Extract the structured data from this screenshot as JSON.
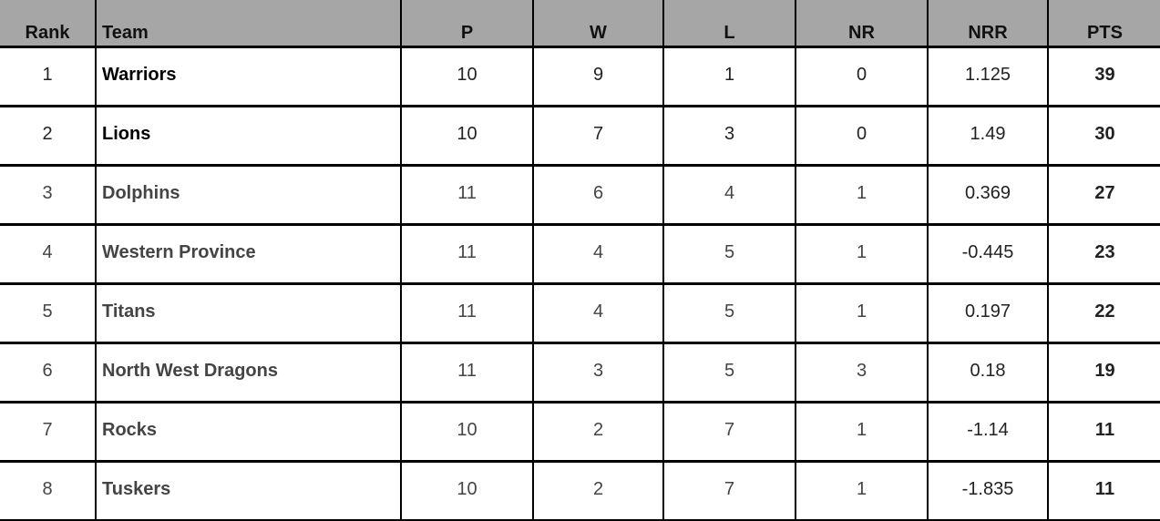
{
  "table": {
    "headers": {
      "rank": "Rank",
      "team": "Team",
      "p": "P",
      "w": "W",
      "l": "L",
      "nr": "NR",
      "nrr": "NRR",
      "pts": "PTS"
    },
    "header_bg": "#a6a6a6",
    "rows": [
      {
        "rank": "1",
        "team": "Warriors",
        "p": "10",
        "w": "9",
        "l": "1",
        "nr": "0",
        "nrr": "1.125",
        "pts": "39"
      },
      {
        "rank": "2",
        "team": "Lions",
        "p": "10",
        "w": "7",
        "l": "3",
        "nr": "0",
        "nrr": "1.49",
        "pts": "30"
      },
      {
        "rank": "3",
        "team": "Dolphins",
        "p": "11",
        "w": "6",
        "l": "4",
        "nr": "1",
        "nrr": "0.369",
        "pts": "27"
      },
      {
        "rank": "4",
        "team": "Western Province",
        "p": "11",
        "w": "4",
        "l": "5",
        "nr": "1",
        "nrr": "-0.445",
        "pts": "23"
      },
      {
        "rank": "5",
        "team": "Titans",
        "p": "11",
        "w": "4",
        "l": "5",
        "nr": "1",
        "nrr": "0.197",
        "pts": "22"
      },
      {
        "rank": "6",
        "team": "North West Dragons",
        "p": "11",
        "w": "3",
        "l": "5",
        "nr": "3",
        "nrr": "0.18",
        "pts": "19"
      },
      {
        "rank": "7",
        "team": "Rocks",
        "p": "10",
        "w": "2",
        "l": "7",
        "nr": "1",
        "nrr": "-1.14",
        "pts": "11"
      },
      {
        "rank": "8",
        "team": "Tuskers",
        "p": "10",
        "w": "2",
        "l": "7",
        "nr": "1",
        "nrr": "-1.835",
        "pts": "11"
      }
    ]
  }
}
